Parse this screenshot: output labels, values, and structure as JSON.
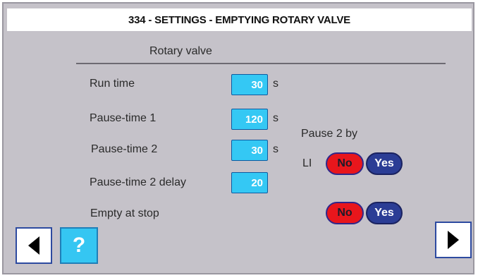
{
  "screen": {
    "title": "334 - SETTINGS - EMPTYING ROTARY VALVE"
  },
  "section": {
    "title": "Rotary valve"
  },
  "settings": [
    {
      "label": "Run time",
      "value": "30",
      "unit": "s"
    },
    {
      "label": "Pause-time 1",
      "value": "120",
      "unit": "s"
    },
    {
      "label": "Pause-time 2",
      "value": "30",
      "unit": "s"
    },
    {
      "label": "Pause-time 2 delay",
      "value": "20",
      "unit": ""
    }
  ],
  "pause2_by_li": {
    "label_line1": "Pause 2 by",
    "label_line2": "LI",
    "no_label": "No",
    "yes_label": "Yes"
  },
  "empty_at_stop": {
    "label": "Empty at stop",
    "no_label": "No",
    "yes_label": "Yes"
  },
  "nav": {
    "help_label": "?",
    "back_icon": "triangle-left-icon",
    "forward_icon": "triangle-right-icon"
  },
  "colors": {
    "background": "#c5c2c9",
    "field": "#34c8f4",
    "no_active": "#e8161c",
    "yes": "#2b3d95"
  }
}
